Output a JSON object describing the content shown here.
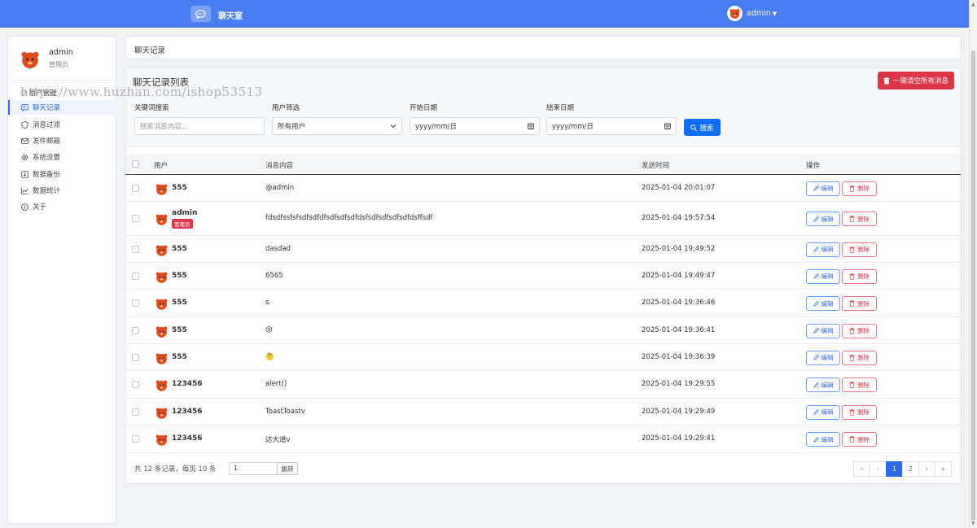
{
  "header": {
    "title": "聊天室",
    "user_name": "admin"
  },
  "sidebar": {
    "profile": {
      "name": "admin",
      "role": "管理员"
    },
    "group_label": "用户管理",
    "items": [
      {
        "label": "聊天记录",
        "icon": "chat-icon",
        "active": true
      },
      {
        "label": "消息过滤",
        "icon": "shield-icon"
      },
      {
        "label": "发件邮箱",
        "icon": "mail-icon"
      },
      {
        "label": "系统设置",
        "icon": "gear-icon"
      },
      {
        "label": "数据备份",
        "icon": "backup-icon"
      },
      {
        "label": "数据统计",
        "icon": "chart-icon"
      },
      {
        "label": "关于",
        "icon": "info-icon"
      }
    ]
  },
  "watermark": "https://www.huzhan.com/ishop53513",
  "breadcrumb": {
    "current": "聊天记录"
  },
  "list": {
    "title": "聊天记录列表",
    "clear_all_label": "一键清空所有消息",
    "filters": {
      "keyword_label": "关键词搜索",
      "keyword_placeholder": "搜索消息内容...",
      "user_label": "用户筛选",
      "user_value": "所有用户",
      "start_label": "开始日期",
      "start_placeholder": "yyyy/mm/日",
      "end_label": "结束日期",
      "end_placeholder": "yyyy/mm/日",
      "search_label": "搜索"
    },
    "columns": {
      "user": "用户",
      "content": "消息内容",
      "time": "发送时间",
      "actions": "操作"
    },
    "edit_label": "编辑",
    "delete_label": "删除",
    "admin_badge": "管理员",
    "rows": [
      {
        "user": "555",
        "content": "@admin",
        "time": "2025-01-04 20:01:07"
      },
      {
        "user": "admin",
        "content": "fdsdfssfsfsdfsdfdfsdfsdfsdfdsfsdfsdfsdfsdfdsffsdf",
        "time": "2025-01-04 19:57:54",
        "is_admin": true
      },
      {
        "user": "555",
        "content": "dasdad",
        "time": "2025-01-04 19:49:52"
      },
      {
        "user": "555",
        "content": "6565",
        "time": "2025-01-04 19:49:47"
      },
      {
        "user": "555",
        "content": "s",
        "time": "2025-01-04 19:36:46"
      },
      {
        "user": "555",
        "content": "😝",
        "time": "2025-01-04 19:36:41"
      },
      {
        "user": "555",
        "content": "🤔",
        "time": "2025-01-04 19:36:39"
      },
      {
        "user": "123456",
        "content": "alert()",
        "time": "2025-01-04 19:29:55"
      },
      {
        "user": "123456",
        "content": "ToastToastv",
        "time": "2025-01-04 19:29:49"
      },
      {
        "user": "123456",
        "content": "达大道v",
        "time": "2025-01-04 19:29:41"
      }
    ],
    "summary": "共 12 条记录，每页 10 条",
    "jump_value": "1",
    "jump_label": "跳转",
    "pages": [
      "1",
      "2"
    ],
    "current_page": "1"
  },
  "colors": {
    "primary": "#4a7df0",
    "danger": "#dc3545",
    "link": "#2f6ae6"
  }
}
